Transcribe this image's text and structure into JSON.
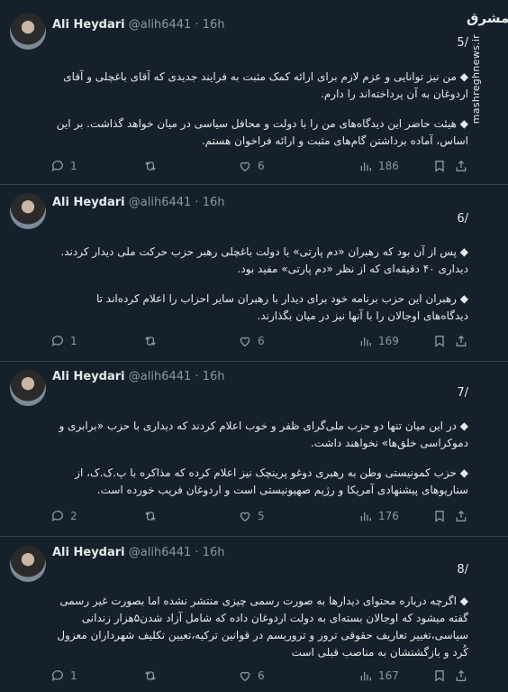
{
  "watermark": {
    "logo": "مشرق",
    "site": "mashreghnews.ir"
  },
  "tweets": [
    {
      "author": "Ali Heydari",
      "handle": "@alih6441",
      "sep": "·",
      "time": "16h",
      "number": "5/",
      "paragraphs": [
        "◆ من نیز توانایی و عزم لازم برای ارائه کمک مثبت به فرایند جدیدی که آقای باغچلی و آقای اردوغان به آن پرداخته‌اند را دارم.",
        "◆ هیئت حاضر این دیدگاه‌های من را با دولت و محافل سیاسی در میان خواهد گذاشت. بر این اساس، آماده برداشتن گام‌های مثبت و ارائه فراخوان هستم."
      ],
      "replies": "1",
      "retweets": "",
      "likes": "6",
      "views": "186"
    },
    {
      "author": "Ali Heydari",
      "handle": "@alih6441",
      "sep": "·",
      "time": "16h",
      "number": "6/",
      "paragraphs": [
        "◆ پس از آن بود که رهبران «دم پارتی» با دولت باغچلی رهبر حزب حرکت ملی دیدار کردند. دیداری ۴۰ دقیقه‌ای که از نظر «دم پارتی» مفید بود.",
        "◆ رهبران این حزب برنامه خود برای دیدار با رهبران سایر احزاب را اعلام کرده‌اند تا دیدگاه‌های اوجالان را با آنها نیز در میان بگذارند."
      ],
      "replies": "1",
      "retweets": "",
      "likes": "6",
      "views": "169"
    },
    {
      "author": "Ali Heydari",
      "handle": "@alih6441",
      "sep": "·",
      "time": "16h",
      "number": "7/",
      "paragraphs": [
        "◆ در این میان تنها دو حزب ملی‌گرای ظفر و خوب اعلام کردند که دیداری با حزب «برابری و دموکراسی خلق‌ها» نخواهند داشت.",
        "◆ حزب کمونیستی وطن به رهبری دوغو پرینچک نیز اعلام کرده که مذاکره با پ.ک.ک، از سناریوهای پیشنهادی آمریکا و رژیم صهیونیستی است و اردوغان فریب خورده است."
      ],
      "replies": "2",
      "retweets": "",
      "likes": "5",
      "views": "176"
    },
    {
      "author": "Ali Heydari",
      "handle": "@alih6441",
      "sep": "·",
      "time": "16h",
      "number": "8/",
      "paragraphs": [
        "◆ اگرچه درباره محتوای دیدارها به صورت رسمی چیزی منتشر نشده اما بصورت غیر رسمی گفته میشود که اوجالان بسته‌ای به دولت اردوغان داده که شامل آزاد شدن۵هزار زندانی سیاسی،تغییر تعاریف حقوقی ترور و تروریسم در قوانین ترکیه،تعیین تکلیف شهرداران معزول کُرد و بازگشتشان به مناصب قبلی است"
      ],
      "replies": "1",
      "retweets": "",
      "likes": "6",
      "views": "167"
    }
  ]
}
